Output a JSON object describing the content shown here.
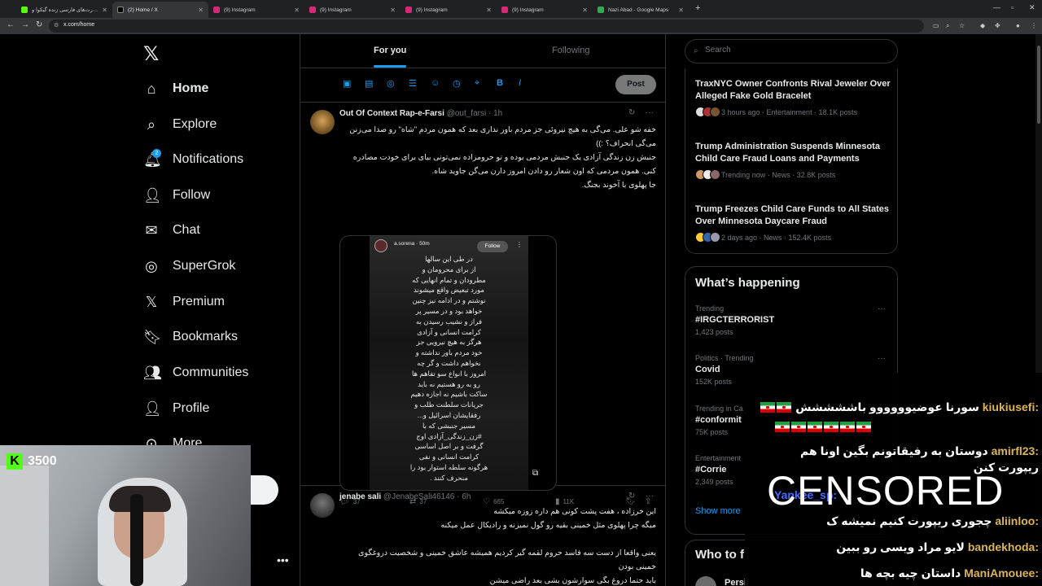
{
  "browser": {
    "tabs": [
      {
        "title": "اسارت‌های فارسی زنده گیکوا و ..."
      },
      {
        "title": "(2) Home / X"
      },
      {
        "title": "(9) Instagram"
      },
      {
        "title": "(9) Instagram"
      },
      {
        "title": "(9) Instagram"
      },
      {
        "title": "(9) Instagram"
      },
      {
        "title": "Nazi Abad - Google Maps"
      }
    ],
    "url": "x.com/home"
  },
  "nav": {
    "items": [
      {
        "label": "Home"
      },
      {
        "label": "Explore"
      },
      {
        "label": "Notifications"
      },
      {
        "label": "Follow"
      },
      {
        "label": "Chat"
      },
      {
        "label": "SuperGrok"
      },
      {
        "label": "Premium"
      },
      {
        "label": "Bookmarks"
      },
      {
        "label": "Communities"
      },
      {
        "label": "Profile"
      },
      {
        "label": "More"
      }
    ],
    "notifications_badge": "2"
  },
  "feed": {
    "tab_for_you": "For you",
    "tab_following": "Following",
    "post_button": "Post"
  },
  "tweet1": {
    "name": "Out Of Context Rap-e-Farsi",
    "handle": "@out_farsi",
    "time": "· 1h",
    "lines": [
      "خفه شو علی. می‌گی به هیچ نیروئی جز مردم باور نداری بعد که همون مردم \"شاه\" رو صدا می‌زنن می‌گی انحراف؟ :))",
      "جنبش زن زندگی آزادی یک جنبش مردمی بوده و تو حرومزاده نمی‌تونی بیای برای خودت مصادره کنی. همون مردمی که اون شعار رو دادن امروز دارن می‌گن جاوید شاه.",
      "جا پهلوی با آخوند بجنگ."
    ],
    "story": {
      "handle": "a.sorena · 50m",
      "follow": "Follow",
      "lines": [
        "در طی این سالها",
        "از برای محرومان و",
        "مطرودان و تمام انهایی که",
        "مورد تبعیض واقع میشوند",
        "نوشتم و در ادامه نیز چنین",
        "خواهد بود و در مسیر پر",
        "فراز و نشیب رسیدن به",
        "کرامت انسانی و آزادی",
        "هرگز به هیچ نیرویی جز",
        "خود مردم باور نداشته و",
        "نخواهم داشت و گر چه",
        "امروز با انواع سو تفاهم ها",
        "رو به رو هستیم نه باید",
        "ساکت باشیم نه اجازه دهیم",
        "جریانات سلطنت طلب و",
        "رفقایشان اسرائیل و...",
        "مسیر جنبشی که با",
        "#زن_زندگی_آزادی اوج",
        "گرفت و بر اصل اساسی",
        "کرامت انسانی و نفی",
        "هرگونه سلطه استوار بود را",
        "منحرف کنند ."
      ]
    },
    "replies": "37",
    "reposts": "37",
    "likes": "665",
    "views": "11K"
  },
  "tweet2": {
    "name": "jenabe sali",
    "handle": "@JenabeSali46146",
    "time": "· 6h",
    "lines": [
      "این خرزاده ، هفت پشت کونی هم داره زوزه میکشه",
      "میگه چرا پهلوی مثل خمینی بقیه رو گول نمیزنه و رادیکال عمل میکنه",
      "",
      "یعنی واقعا از دست سه فاسد حروم لقمه گیر کردیم همیشه عاشق خمینی و شخصیت دروغگوی خمینی بودن",
      "باید حتما دروغ بگی سوارشون بشی بعد راضی میشن"
    ]
  },
  "search": {
    "placeholder": "Search"
  },
  "news": [
    {
      "title": "TraxNYC Owner Confronts Rival Jeweler Over Alleged Fake Gold Bracelet",
      "meta": "3 hours ago · Entertainment · 18.1K posts"
    },
    {
      "title": "Trump Administration Suspends Minnesota Child Care Fraud Loans and Payments",
      "meta": "Trending now · News · 32.8K posts"
    },
    {
      "title": "Trump Freezes Child Care Funds to All States Over Minnesota Daycare Fraud",
      "meta": "2 days ago · News · 152.4K posts"
    }
  ],
  "happening": {
    "title": "What’s happening",
    "trends": [
      {
        "context": "Trending",
        "name": "#IRGCTERRORIST",
        "posts": "1,423 posts"
      },
      {
        "context": "Politics · Trending",
        "name": "Covid",
        "posts": "152K posts"
      },
      {
        "context": "Trending in Ca",
        "name": "#conformit",
        "posts": "75K posts"
      },
      {
        "context": "Entertainment",
        "name": "#Corrie",
        "posts": "2,349 posts"
      }
    ],
    "show_more": "Show more"
  },
  "who_to_follow": {
    "title": "Who to f",
    "first_name": "Persi"
  },
  "stream": {
    "kick_count": "3500",
    "censored": "CENSORED",
    "chat": [
      {
        "user": "kiukiusefi:",
        "text": "سورنا عوضیوووووو باششششش"
      },
      {
        "user": "amirfl23:",
        "text": "دوستان به رفیقاتونم بگین اونا هم ریپورت کنن"
      },
      {
        "user": "Yankee_sp:",
        "text": ""
      },
      {
        "user": "aliinloo:",
        "text": "چجوری ریپورت کنیم نمیشه ک"
      },
      {
        "user": "bandekhoda:",
        "text": "لایو مراد ویسی رو ببین"
      },
      {
        "user": "ManiAmouee:",
        "text": "داستان چیه بچه ها"
      }
    ]
  }
}
